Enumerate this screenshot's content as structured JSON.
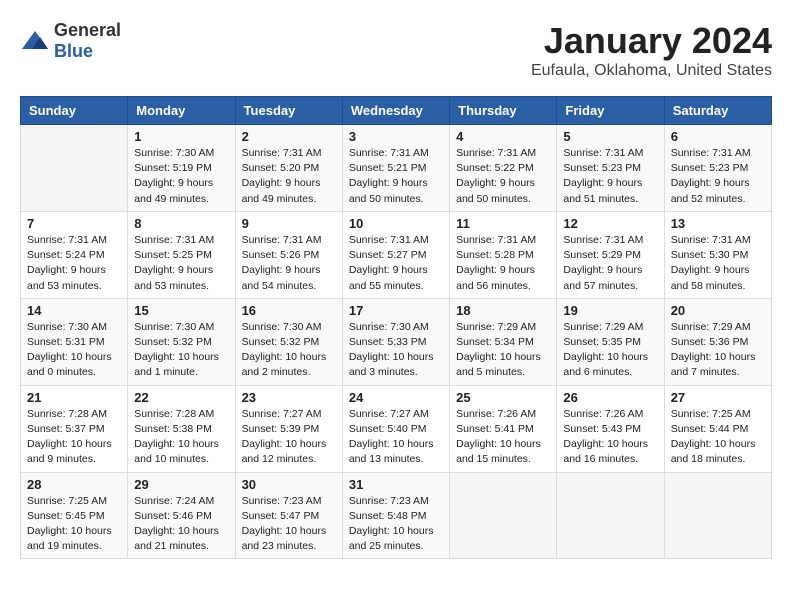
{
  "header": {
    "logo_general": "General",
    "logo_blue": "Blue",
    "month_year": "January 2024",
    "location": "Eufaula, Oklahoma, United States"
  },
  "days_of_week": [
    "Sunday",
    "Monday",
    "Tuesday",
    "Wednesday",
    "Thursday",
    "Friday",
    "Saturday"
  ],
  "weeks": [
    [
      {
        "day": "",
        "info": ""
      },
      {
        "day": "1",
        "info": "Sunrise: 7:30 AM\nSunset: 5:19 PM\nDaylight: 9 hours\nand 49 minutes."
      },
      {
        "day": "2",
        "info": "Sunrise: 7:31 AM\nSunset: 5:20 PM\nDaylight: 9 hours\nand 49 minutes."
      },
      {
        "day": "3",
        "info": "Sunrise: 7:31 AM\nSunset: 5:21 PM\nDaylight: 9 hours\nand 50 minutes."
      },
      {
        "day": "4",
        "info": "Sunrise: 7:31 AM\nSunset: 5:22 PM\nDaylight: 9 hours\nand 50 minutes."
      },
      {
        "day": "5",
        "info": "Sunrise: 7:31 AM\nSunset: 5:23 PM\nDaylight: 9 hours\nand 51 minutes."
      },
      {
        "day": "6",
        "info": "Sunrise: 7:31 AM\nSunset: 5:23 PM\nDaylight: 9 hours\nand 52 minutes."
      }
    ],
    [
      {
        "day": "7",
        "info": "Sunrise: 7:31 AM\nSunset: 5:24 PM\nDaylight: 9 hours\nand 53 minutes."
      },
      {
        "day": "8",
        "info": "Sunrise: 7:31 AM\nSunset: 5:25 PM\nDaylight: 9 hours\nand 53 minutes."
      },
      {
        "day": "9",
        "info": "Sunrise: 7:31 AM\nSunset: 5:26 PM\nDaylight: 9 hours\nand 54 minutes."
      },
      {
        "day": "10",
        "info": "Sunrise: 7:31 AM\nSunset: 5:27 PM\nDaylight: 9 hours\nand 55 minutes."
      },
      {
        "day": "11",
        "info": "Sunrise: 7:31 AM\nSunset: 5:28 PM\nDaylight: 9 hours\nand 56 minutes."
      },
      {
        "day": "12",
        "info": "Sunrise: 7:31 AM\nSunset: 5:29 PM\nDaylight: 9 hours\nand 57 minutes."
      },
      {
        "day": "13",
        "info": "Sunrise: 7:31 AM\nSunset: 5:30 PM\nDaylight: 9 hours\nand 58 minutes."
      }
    ],
    [
      {
        "day": "14",
        "info": "Sunrise: 7:30 AM\nSunset: 5:31 PM\nDaylight: 10 hours\nand 0 minutes."
      },
      {
        "day": "15",
        "info": "Sunrise: 7:30 AM\nSunset: 5:32 PM\nDaylight: 10 hours\nand 1 minute."
      },
      {
        "day": "16",
        "info": "Sunrise: 7:30 AM\nSunset: 5:32 PM\nDaylight: 10 hours\nand 2 minutes."
      },
      {
        "day": "17",
        "info": "Sunrise: 7:30 AM\nSunset: 5:33 PM\nDaylight: 10 hours\nand 3 minutes."
      },
      {
        "day": "18",
        "info": "Sunrise: 7:29 AM\nSunset: 5:34 PM\nDaylight: 10 hours\nand 5 minutes."
      },
      {
        "day": "19",
        "info": "Sunrise: 7:29 AM\nSunset: 5:35 PM\nDaylight: 10 hours\nand 6 minutes."
      },
      {
        "day": "20",
        "info": "Sunrise: 7:29 AM\nSunset: 5:36 PM\nDaylight: 10 hours\nand 7 minutes."
      }
    ],
    [
      {
        "day": "21",
        "info": "Sunrise: 7:28 AM\nSunset: 5:37 PM\nDaylight: 10 hours\nand 9 minutes."
      },
      {
        "day": "22",
        "info": "Sunrise: 7:28 AM\nSunset: 5:38 PM\nDaylight: 10 hours\nand 10 minutes."
      },
      {
        "day": "23",
        "info": "Sunrise: 7:27 AM\nSunset: 5:39 PM\nDaylight: 10 hours\nand 12 minutes."
      },
      {
        "day": "24",
        "info": "Sunrise: 7:27 AM\nSunset: 5:40 PM\nDaylight: 10 hours\nand 13 minutes."
      },
      {
        "day": "25",
        "info": "Sunrise: 7:26 AM\nSunset: 5:41 PM\nDaylight: 10 hours\nand 15 minutes."
      },
      {
        "day": "26",
        "info": "Sunrise: 7:26 AM\nSunset: 5:43 PM\nDaylight: 10 hours\nand 16 minutes."
      },
      {
        "day": "27",
        "info": "Sunrise: 7:25 AM\nSunset: 5:44 PM\nDaylight: 10 hours\nand 18 minutes."
      }
    ],
    [
      {
        "day": "28",
        "info": "Sunrise: 7:25 AM\nSunset: 5:45 PM\nDaylight: 10 hours\nand 19 minutes."
      },
      {
        "day": "29",
        "info": "Sunrise: 7:24 AM\nSunset: 5:46 PM\nDaylight: 10 hours\nand 21 minutes."
      },
      {
        "day": "30",
        "info": "Sunrise: 7:23 AM\nSunset: 5:47 PM\nDaylight: 10 hours\nand 23 minutes."
      },
      {
        "day": "31",
        "info": "Sunrise: 7:23 AM\nSunset: 5:48 PM\nDaylight: 10 hours\nand 25 minutes."
      },
      {
        "day": "",
        "info": ""
      },
      {
        "day": "",
        "info": ""
      },
      {
        "day": "",
        "info": ""
      }
    ]
  ]
}
